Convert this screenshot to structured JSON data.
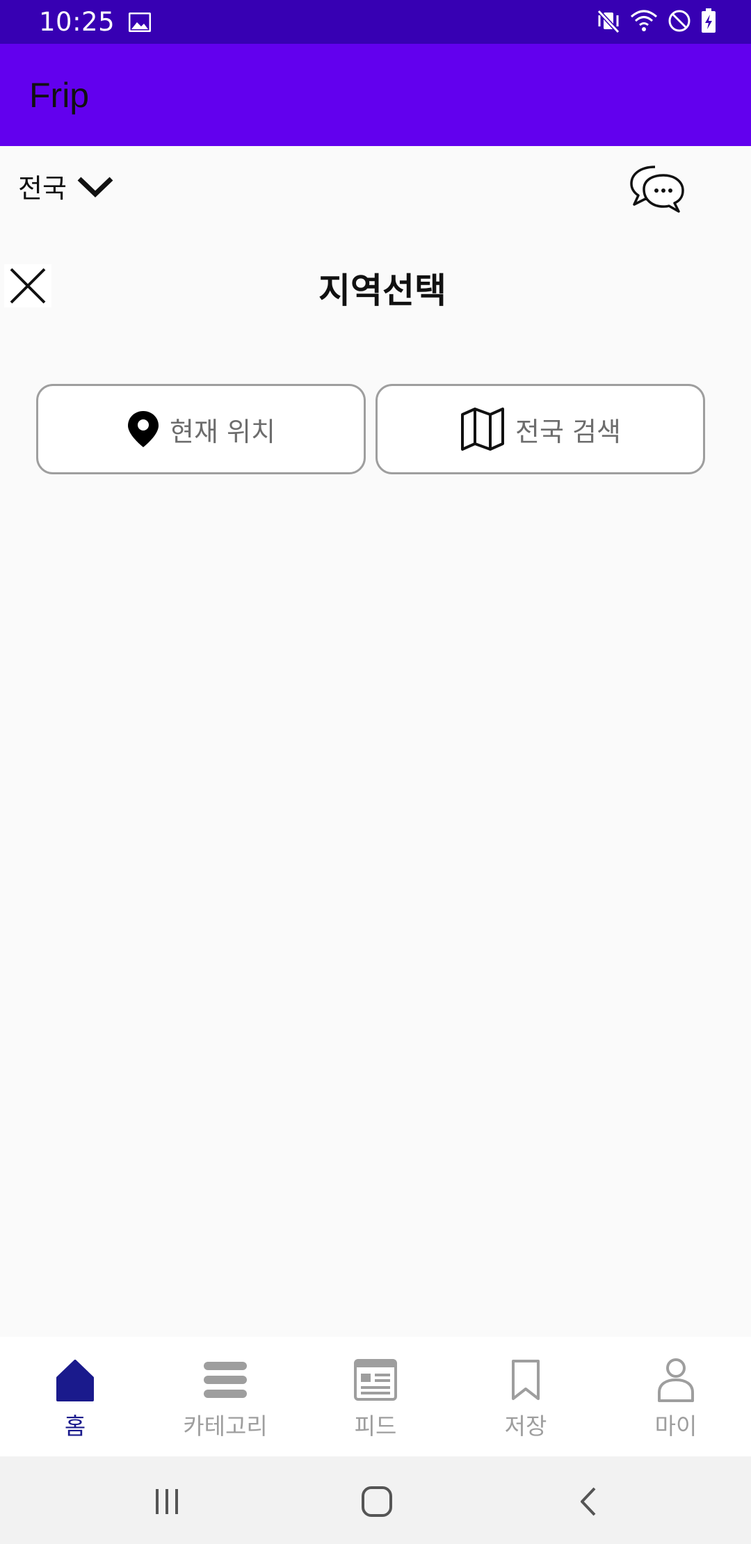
{
  "status_bar": {
    "time": "10:25",
    "icons": [
      "image-icon",
      "mute-vibrate-icon",
      "wifi-icon",
      "do-not-disturb-icon",
      "battery-charging-icon"
    ]
  },
  "app_bar": {
    "title": "Frip"
  },
  "region_row": {
    "region_label": "전국",
    "dropdown_icon": "chevron-down-icon",
    "chat_icon": "chat-bubbles-icon"
  },
  "region_sheet": {
    "title": "지역선택",
    "close_icon": "close-icon",
    "buttons": [
      {
        "label": "현재 위치",
        "icon": "location-pin-icon"
      },
      {
        "label": "전국 검색",
        "icon": "map-icon"
      }
    ]
  },
  "bottom_nav": {
    "items": [
      {
        "label": "홈",
        "icon": "home-icon",
        "active": true
      },
      {
        "label": "카테고리",
        "icon": "category-icon",
        "active": false
      },
      {
        "label": "피드",
        "icon": "feed-icon",
        "active": false
      },
      {
        "label": "저장",
        "icon": "bookmark-icon",
        "active": false
      },
      {
        "label": "마이",
        "icon": "person-icon",
        "active": false
      }
    ]
  },
  "colors": {
    "status_bar": "#3700b3",
    "app_bar": "#6200ee",
    "active_nav": "#1a1a8c",
    "inactive_nav": "#9e9e9e",
    "background": "#fafafa"
  }
}
